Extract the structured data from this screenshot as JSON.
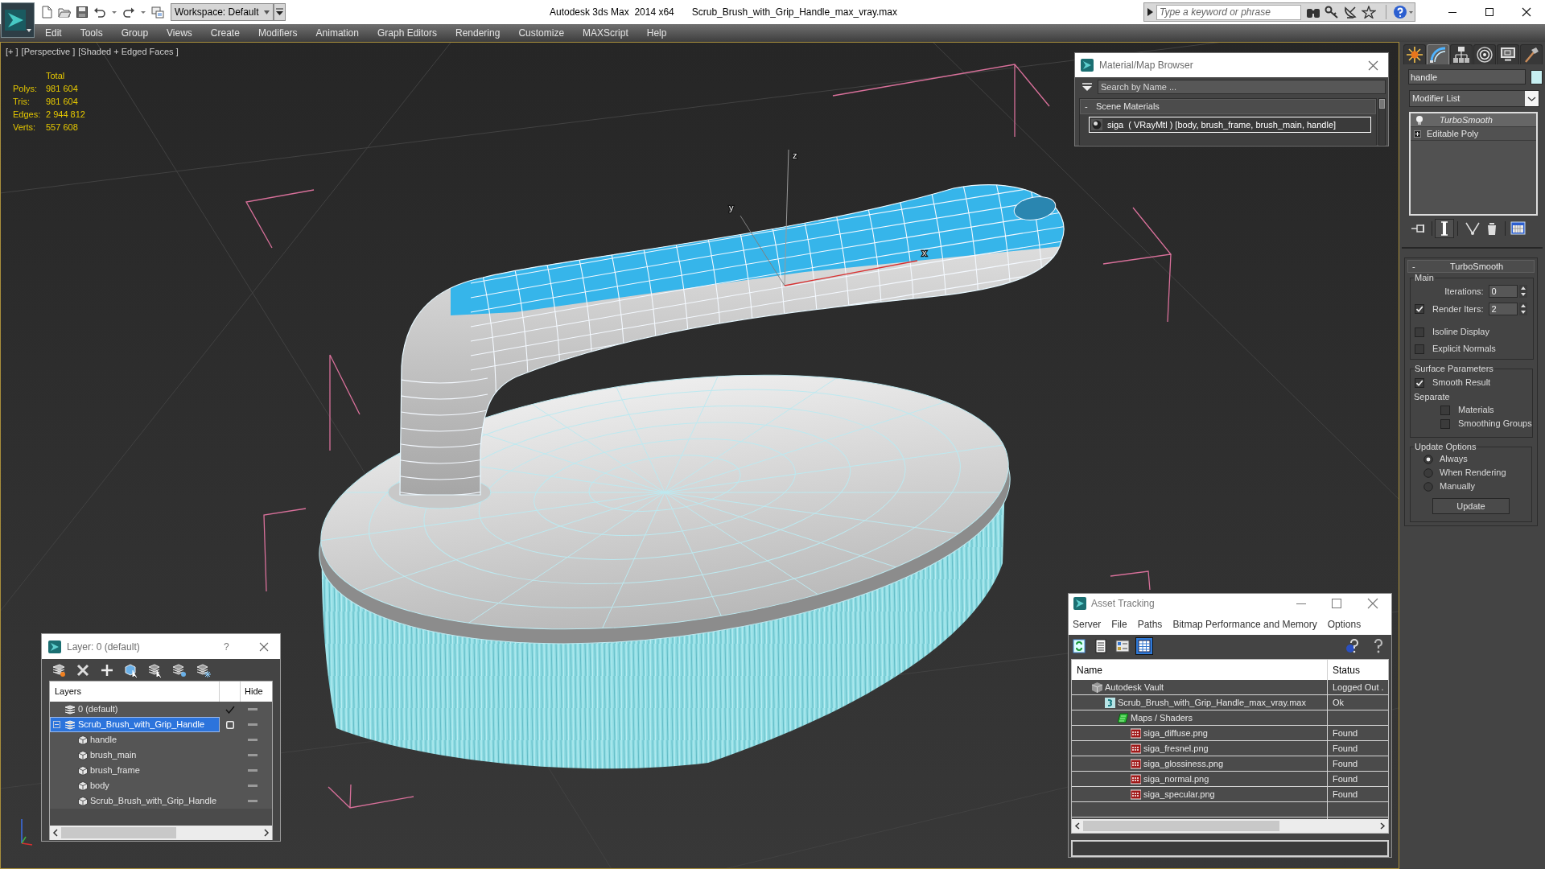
{
  "title_bar": {
    "workspace": "Workspace: Default",
    "app_title": "Autodesk 3ds Max  2014 x64",
    "file_name": "Scrub_Brush_with_Grip_Handle_max_vray.max",
    "search": {
      "placeholder": "Type a keyword or phrase"
    }
  },
  "menu": [
    "Edit",
    "Tools",
    "Group",
    "Views",
    "Create",
    "Modifiers",
    "Animation",
    "Graph Editors",
    "Rendering",
    "Customize",
    "MAXScript",
    "Help"
  ],
  "viewport": {
    "labels": [
      "[+ ]",
      "[Perspective ]",
      "[Shaded + Edged Faces ]"
    ],
    "stats": {
      "heading": "Total",
      "rows": [
        {
          "label": "Polys:",
          "value": "981 604"
        },
        {
          "label": "Tris:",
          "value": "981 604"
        },
        {
          "label": "Edges:",
          "value": "2 944 812"
        },
        {
          "label": "Verts:",
          "value": "557 608"
        }
      ]
    },
    "pivot_labels": [
      "z",
      "y",
      "x"
    ]
  },
  "material_browser": {
    "title": "Material/Map Browser",
    "search": {
      "placeholder": "Search by Name ..."
    },
    "group": {
      "toggle": "-",
      "label": "Scene Materials"
    },
    "materials": [
      {
        "label": "siga  ( VRayMtl ) [body, brush_frame, brush_main, handle]",
        "selected": true
      }
    ]
  },
  "command_panel": {
    "tabs": [
      {
        "kind": "create",
        "selected": false
      },
      {
        "kind": "modify",
        "selected": true
      },
      {
        "kind": "hierarchy",
        "selected": false
      },
      {
        "kind": "motion",
        "selected": false
      },
      {
        "kind": "display",
        "selected": false
      },
      {
        "kind": "utilities",
        "selected": false
      }
    ],
    "object_name": "handle",
    "modifier_list": "Modifier List",
    "stack": [
      {
        "kind": "modifier",
        "label": "TurboSmooth",
        "selected": true,
        "shown_in_viewport": false
      },
      {
        "kind": "object",
        "label": "Editable Poly",
        "selected": false,
        "shown_in_viewport": true
      }
    ],
    "stack_tools": [
      {
        "kind": "pin",
        "on": false
      },
      {
        "kind": "end-result",
        "on": true
      },
      {
        "kind": "unique",
        "on": false
      },
      {
        "kind": "remove",
        "on": false
      },
      {
        "kind": "configure",
        "on": false
      }
    ],
    "rollout": {
      "toggle": "-",
      "title": "TurboSmooth",
      "groups": [
        {
          "title": "Main",
          "controls": [
            {
              "kind": "spinner",
              "label": "Iterations:",
              "value": "0"
            },
            {
              "kind": "check-spinner",
              "label": "Render Iters:",
              "checked": true,
              "value": "2"
            },
            {
              "kind": "checkbox",
              "label": "Isoline Display",
              "checked": false
            },
            {
              "kind": "checkbox",
              "label": "Explicit Normals",
              "checked": false
            }
          ]
        },
        {
          "title": "Surface Parameters",
          "controls": [
            {
              "kind": "checkbox",
              "label": "Smooth Result",
              "checked": true
            },
            {
              "kind": "label",
              "label": "Separate",
              "children": [
                {
                  "kind": "checkbox",
                  "label": "Materials",
                  "checked": false
                },
                {
                  "kind": "checkbox",
                  "label": "Smoothing Groups",
                  "checked": false
                }
              ]
            }
          ]
        },
        {
          "title": "Update Options",
          "controls": [
            {
              "kind": "radio",
              "label": "Always",
              "selected": true
            },
            {
              "kind": "radio",
              "label": "When Rendering",
              "selected": false
            },
            {
              "kind": "radio",
              "label": "Manually",
              "selected": false
            },
            {
              "kind": "button",
              "label": "Update"
            }
          ]
        }
      ]
    }
  },
  "layer_dialog": {
    "title": "Layer: 0 (default)",
    "help": "?",
    "columns": [
      "Layers",
      "Hide"
    ],
    "layers": [
      {
        "name": "0 (default)",
        "current": true,
        "selected": false
      },
      {
        "name": "Scrub_Brush_with_Grip_Handle",
        "current": false,
        "selected": true,
        "expanded": true,
        "children": [
          {
            "name": "handle",
            "selected": false
          },
          {
            "name": "brush_main",
            "selected": false
          },
          {
            "name": "brush_frame",
            "selected": false
          },
          {
            "name": "body",
            "selected": false
          },
          {
            "name": "Scrub_Brush_with_Grip_Handle",
            "selected": false
          }
        ]
      }
    ]
  },
  "asset_tracking": {
    "title": "Asset Tracking",
    "menu": [
      "Server",
      "File",
      "Paths",
      "Bitmap Performance and Memory",
      "Options"
    ],
    "toolbar": [
      {
        "kind": "refresh",
        "selected": false
      },
      {
        "kind": "list",
        "selected": false
      },
      {
        "kind": "thumbnails",
        "selected": false
      },
      {
        "kind": "table",
        "selected": true
      }
    ],
    "columns": [
      "Name",
      "Status"
    ],
    "tree": [
      {
        "kind": "vault",
        "name": "Autodesk Vault",
        "status": "Logged Out .",
        "children": [
          {
            "kind": "max",
            "name": "Scrub_Brush_with_Grip_Handle_max_vray.max",
            "status": "Ok",
            "children": [
              {
                "kind": "folder",
                "name": "Maps / Shaders",
                "children": [
                  {
                    "kind": "png",
                    "name": "siga_diffuse.png",
                    "status": "Found"
                  },
                  {
                    "kind": "png",
                    "name": "siga_fresnel.png",
                    "status": "Found"
                  },
                  {
                    "kind": "png",
                    "name": "siga_glossiness.png",
                    "status": "Found"
                  },
                  {
                    "kind": "png",
                    "name": "siga_normal.png",
                    "status": "Found"
                  },
                  {
                    "kind": "png",
                    "name": "siga_specular.png",
                    "status": "Found"
                  }
                ]
              }
            ]
          }
        ]
      }
    ]
  }
}
